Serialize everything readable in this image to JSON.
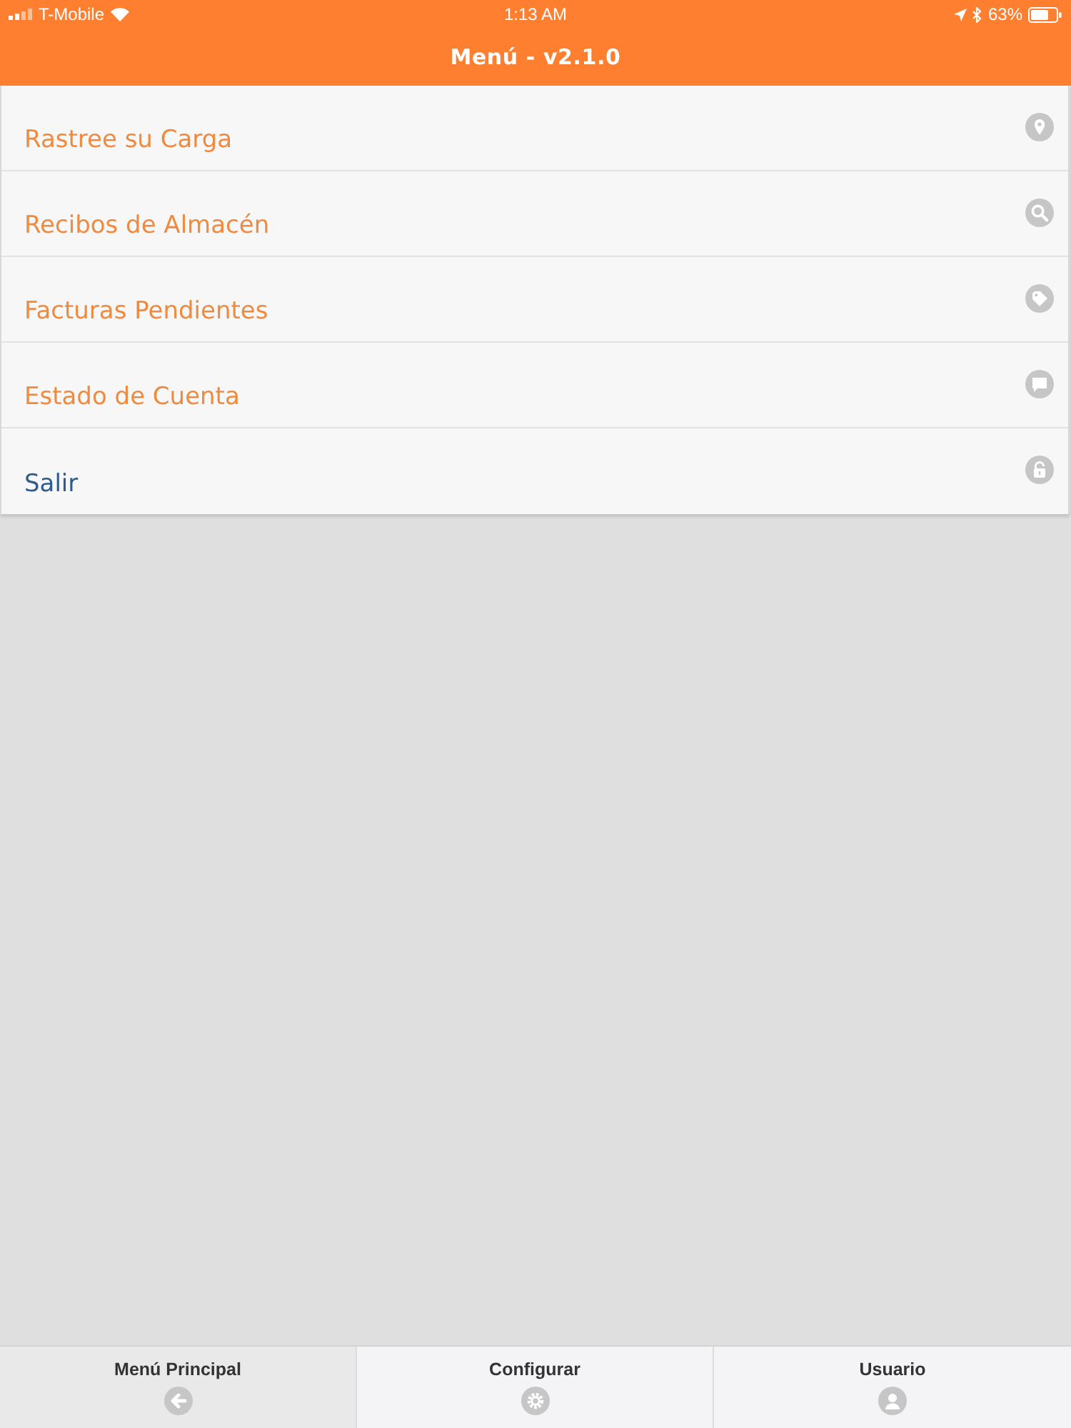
{
  "status_bar": {
    "carrier": "T-Mobile",
    "time": "1:13 AM",
    "battery": "63%"
  },
  "title": "Menú - v2.1.0",
  "menu": {
    "items": [
      {
        "label": "Rastree su Carga",
        "color": "#ef8a3e"
      },
      {
        "label": "Recibos de Almacén",
        "color": "#ef8a3e"
      },
      {
        "label": "Facturas Pendientes",
        "color": "#ef8a3e"
      },
      {
        "label": "Estado de Cuenta",
        "color": "#ef8a3e"
      },
      {
        "label": "Salir",
        "color": "#2e5c8c"
      }
    ]
  },
  "tab_bar": {
    "tabs": [
      {
        "label": "Menú Principal",
        "selected": true
      },
      {
        "label": "Configurar",
        "selected": false
      },
      {
        "label": "Usuario",
        "selected": false
      }
    ]
  }
}
